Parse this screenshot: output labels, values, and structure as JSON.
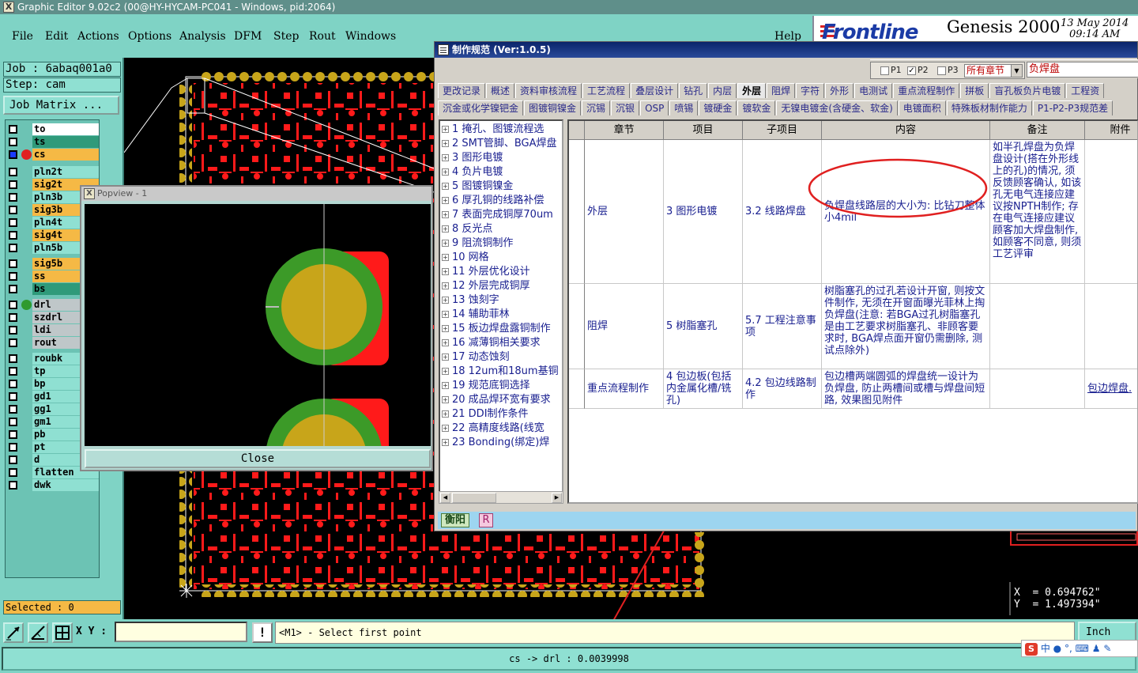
{
  "window": {
    "title": "Graphic Editor 9.02c2 (00@HY-HYCAM-PC041 - Windows, pid:2064)"
  },
  "menu": {
    "items": [
      "File",
      "Edit",
      "Actions",
      "Options",
      "Analysis",
      "DFM",
      "Step",
      "Rout",
      "Windows"
    ],
    "help": "Help"
  },
  "logo": {
    "brand": "Frontline",
    "product": "Genesis 2000",
    "date": "13 May 2014",
    "time": "09:14 AM"
  },
  "left_panel": {
    "job": "Job : 6abaq001a0",
    "step": "Step: cam",
    "job_matrix": "Job Matrix ...",
    "selected": "Selected : 0",
    "layers": [
      {
        "name": "to",
        "color": "#ffffff",
        "dot": ""
      },
      {
        "name": "ts",
        "color": "#2f9a7a",
        "dot": ""
      },
      {
        "name": "cs",
        "color": "#f5b945",
        "dot": "#e02020",
        "active": true
      },
      {
        "name": "pln2t",
        "color": "#8fe0d2",
        "dot": ""
      },
      {
        "name": "sig2t",
        "color": "#f5b945",
        "dot": ""
      },
      {
        "name": "pln3b",
        "color": "#8fe0d2",
        "dot": ""
      },
      {
        "name": "sig3b",
        "color": "#f5b945",
        "dot": ""
      },
      {
        "name": "pln4t",
        "color": "#8fe0d2",
        "dot": ""
      },
      {
        "name": "sig4t",
        "color": "#f5b945",
        "dot": ""
      },
      {
        "name": "pln5b",
        "color": "#8fe0d2",
        "dot": ""
      },
      {
        "name": "sig5b",
        "color": "#f5b945",
        "dot": ""
      },
      {
        "name": "ss",
        "color": "#f5b945",
        "dot": ""
      },
      {
        "name": "bs",
        "color": "#2f9a7a",
        "dot": ""
      },
      {
        "name": "drl",
        "color": "#bfc7c9",
        "dot": "#2f9a2f"
      },
      {
        "name": "szdrl",
        "color": "#bfc7c9",
        "dot": ""
      },
      {
        "name": "ldi",
        "color": "#bfc7c9",
        "dot": ""
      },
      {
        "name": "rout",
        "color": "#bfc7c9",
        "dot": ""
      },
      {
        "name": "roubk",
        "color": "#8fe0d2",
        "dot": ""
      },
      {
        "name": "tp",
        "color": "#8fe0d2",
        "dot": ""
      },
      {
        "name": "bp",
        "color": "#8fe0d2",
        "dot": ""
      },
      {
        "name": "gd1",
        "color": "#8fe0d2",
        "dot": ""
      },
      {
        "name": "gg1",
        "color": "#8fe0d2",
        "dot": ""
      },
      {
        "name": "gm1",
        "color": "#8fe0d2",
        "dot": ""
      },
      {
        "name": "pb",
        "color": "#8fe0d2",
        "dot": ""
      },
      {
        "name": "pt",
        "color": "#8fe0d2",
        "dot": ""
      },
      {
        "name": "d",
        "color": "#8fe0d2",
        "dot": ""
      },
      {
        "name": "flatten",
        "color": "#8fe0d2",
        "dot": ""
      },
      {
        "name": "dwk",
        "color": "#8fe0d2",
        "dot": ""
      }
    ]
  },
  "popview": {
    "title": "Popview - 1",
    "close": "Close"
  },
  "spec_dialog": {
    "title": "制作规范 (Ver:1.0.5)",
    "filter": {
      "p1": "P1",
      "p2": "P2",
      "p3": "P3",
      "chapter_select": "所有章节",
      "search_value": "负焊盘"
    },
    "tabs_row1": [
      "更改记录",
      "概述",
      "资料审核流程",
      "工艺流程",
      "叠层设计",
      "钻孔",
      "内层",
      "外层",
      "阻焊",
      "字符",
      "外形",
      "电测试",
      "重点流程制作",
      "拼板",
      "盲孔板负片电镀",
      "工程资"
    ],
    "active_tab": "外层",
    "tabs_row2": [
      "沉金或化学镍钯金",
      "图镀铜镍金",
      "沉锡",
      "沉银",
      "OSP",
      "喷锡",
      "镀硬金",
      "镀软金",
      "无镍电镀金(含硬金、软金)",
      "电镀面积",
      "特殊板材制作能力",
      "P1-P2-P3规范差"
    ],
    "tree": [
      "1 掩孔、图镀流程选",
      "2 SMT管脚、BGA焊盘",
      "3 图形电镀",
      "4 负片电镀",
      "5 图镀铜镍金",
      "6 厚孔铜的线路补偿",
      "7 表面完成铜厚70um",
      "8 反光点",
      "9 阻流铜制作",
      "10 网格",
      "11 外层优化设计",
      "12 外层完成铜厚",
      "13 蚀刻字",
      "14 辅助菲林",
      "15 板边焊盘露铜制作",
      "16 减薄铜相关要求",
      "17 动态蚀刻",
      "18 12um和18um基铜",
      "19 规范底铜选择",
      "20 成品焊环宽有要求",
      "21 DDI制作条件",
      "22 高精度线路(线宽",
      "23 Bonding(绑定)焊"
    ],
    "grid": {
      "headers": [
        "章节",
        "项目",
        "子项目",
        "内容",
        "备注",
        "附件"
      ],
      "rows": [
        {
          "chapter": "外层",
          "item": "3 图形电镀",
          "subitem": "3.2 线路焊盘",
          "content": "负焊盘线路层的大小为: 比钻刀整体小4mil",
          "remark": "如半孔焊盘为负焊盘设计(搭在外形线上的孔)的情况, 须反馈顾客确认, 如该孔无电气连接应建议按NPTH制作; 存在电气连接应建议顾客加大焊盘制作, 如顾客不同意, 则须工艺评审",
          "attachment": ""
        },
        {
          "chapter": "阻焊",
          "item": "5 树脂塞孔",
          "subitem": "5.7 工程注意事项",
          "content": "树脂塞孔的过孔若设计开窗, 则按文件制作, 无须在开窗面曝光菲林上掏负焊盘(注意: 若BGA过孔树脂塞孔是由工艺要求树脂塞孔、非顾客要求时, BGA焊点面开窗仍需删除, 测试点除外)",
          "remark": "",
          "attachment": ""
        },
        {
          "chapter": "重点流程制作",
          "item": "4 包边板(包括内金属化槽/铣孔)",
          "subitem": "4.2 包边线路制作",
          "content": "包边槽两端圆弧的焊盘统一设计为负焊盘, 防止两槽间或槽与焊盘间短路, 效果图见附件",
          "remark": "",
          "attachment": "包边焊盘."
        }
      ]
    },
    "bottom": {
      "btn1": "衡阳",
      "btn2": "R"
    }
  },
  "readout": {
    "x": "X  = 0.694762\"",
    "y": "Y  = 1.497394\""
  },
  "bottom": {
    "xy_label": "X Y :",
    "xy_value": "",
    "warn": "!",
    "prompt": "<M1> - Select first point",
    "units": "Inch",
    "status": "cs -> drl : 0.0039998",
    "ime": "中"
  },
  "colors": {
    "copper": "#ff1a1a",
    "pad_ring": "#c8a51a",
    "annotation": "#e02020",
    "panel": "#7fd3c5"
  }
}
